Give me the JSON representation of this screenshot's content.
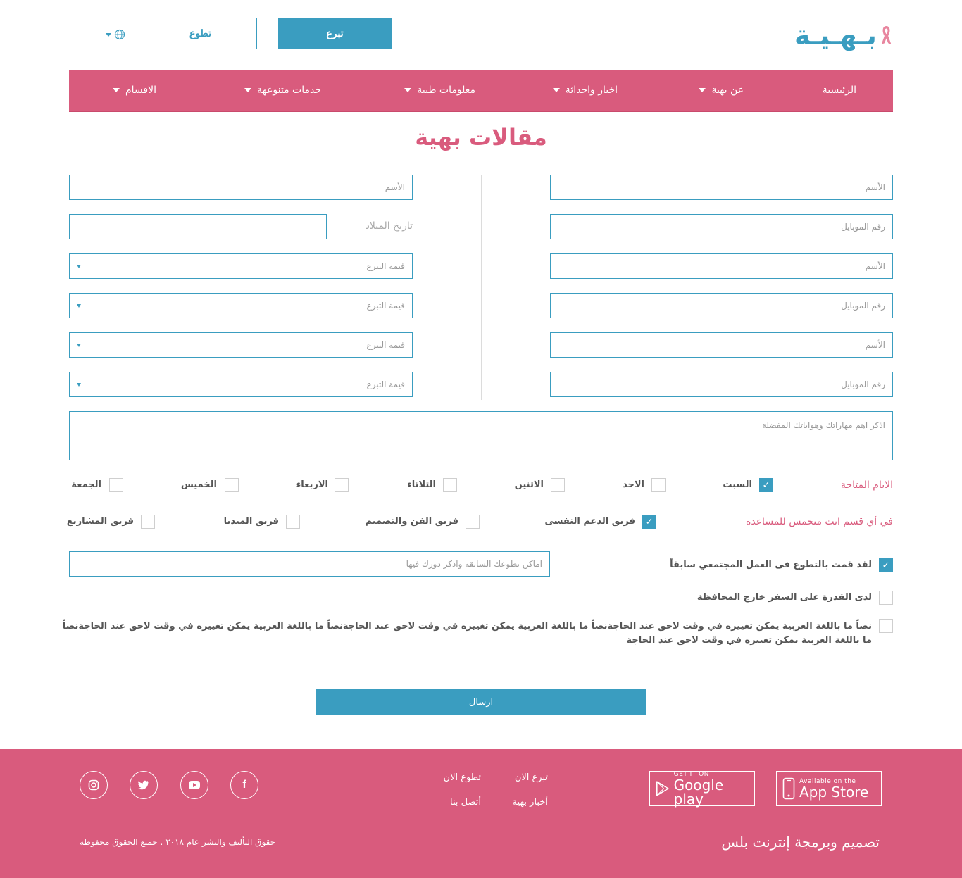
{
  "header": {
    "logo_text": "بـهـيـة",
    "donate_label": "تبرع",
    "volunteer_label": "تطوع"
  },
  "nav": {
    "items": [
      {
        "label": "الرئيسية"
      },
      {
        "label": "عن بهية"
      },
      {
        "label": "اخبار واحداثة"
      },
      {
        "label": "معلومات طبية"
      },
      {
        "label": "خدمات متنوعهة"
      },
      {
        "label": "الاقسام"
      }
    ]
  },
  "page": {
    "title": "مقالات بهية"
  },
  "form": {
    "right_fields": [
      "الأسم",
      "رقم الموبايل",
      "الأسم",
      "رقم الموبايل",
      "الأسم",
      "رقم الموبايل"
    ],
    "left_name": "الأسم",
    "birth_label": "تاريخ الميلاد",
    "selects": [
      "قيمة التبرع",
      "قيمة التبرع",
      "قيمة التبرع",
      "قيمة التبرع"
    ],
    "skills_placeholder": "اذكر اهم مهاراتك وهواياتك المفضلة",
    "days_label": "الايام المتاحة",
    "days": [
      {
        "label": "السبت",
        "checked": true
      },
      {
        "label": "الاحد",
        "checked": false
      },
      {
        "label": "الاثنين",
        "checked": false
      },
      {
        "label": "الثلاثاء",
        "checked": false
      },
      {
        "label": "الاربعاء",
        "checked": false
      },
      {
        "label": "الخميس",
        "checked": false
      },
      {
        "label": "الجمعة",
        "checked": false
      }
    ],
    "teams_label": "في أي قسم انت متحمس للمساعدة",
    "teams": [
      {
        "label": "فريق الدعم النفسى",
        "checked": true
      },
      {
        "label": "فريق الفن والتصميم",
        "checked": false
      },
      {
        "label": "فريق الميديا",
        "checked": false
      },
      {
        "label": "فريق المشاريع",
        "checked": false
      }
    ],
    "prev_volunteer_label": "لقد قمت بالتطوع فى العمل المجتمعي سابقاً",
    "prev_volunteer_checked": true,
    "places_placeholder": "اماكن تطوعك السابقة واذكر دورك فيها",
    "travel_label": "لدى القدرة على السفر خارج المحافظة",
    "travel_checked": false,
    "terms_line1": "نصاً ما باللغة العربية يمكن تغييره في وقت لاحق عند الحاجةنصاً ما باللغة العربية يمكن تغييره في وقت لاحق عند الحاجةنصاً ما باللغة العربية يمكن تغييره في وقت لاحق عند الحاجةنصاً",
    "terms_line2": "ما باللغة العربية يمكن تغييره في وقت لاحق عند الحاجة",
    "terms_checked": false,
    "submit_label": "ارسال"
  },
  "footer": {
    "appstore_small": "Available on the",
    "appstore_big": "App Store",
    "google_small": "GET IT ON",
    "google_big": "Google play",
    "links": {
      "donate_now": "تبرع الان",
      "volunteer_now": "تطوع الان",
      "news": "أخبار بهية",
      "contact": "أتصل بنا"
    },
    "credit": "تصميم وبرمجة إنترنت بلس",
    "copyright": "حقوق التأليف والنشر عام ٢٠١٨ . جميع الحقوق محفوظة",
    "social": [
      "facebook-icon",
      "youtube-icon",
      "twitter-icon",
      "instagram-icon"
    ]
  },
  "colors": {
    "primary": "#3a9dc0",
    "accent": "#d95b7d",
    "footer_bg": "#d95b7d"
  }
}
